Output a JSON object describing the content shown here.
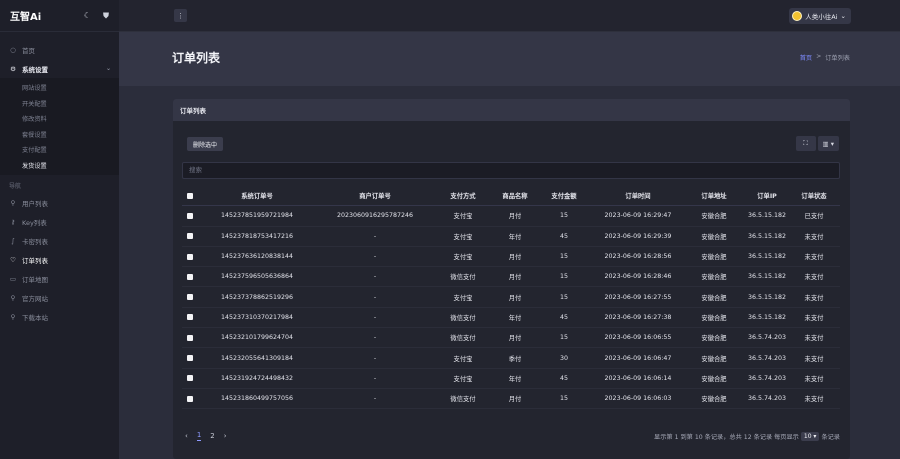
{
  "app": {
    "brand": "互智Ai"
  },
  "sidebar": {
    "items": [
      {
        "label": "首页",
        "icon": "circle-icon"
      },
      {
        "label": "系统设置",
        "icon": "gear-icon"
      }
    ],
    "sub_items": [
      "网站设置",
      "开关配置",
      "修改资料",
      "套餐设置",
      "支付配置",
      "发货设置"
    ],
    "section_label": "导航",
    "nav_items": [
      {
        "label": "用户列表",
        "icon": "user-icon"
      },
      {
        "label": "Key列表",
        "icon": "key-icon"
      },
      {
        "label": "卡密列表",
        "icon": "card-icon"
      },
      {
        "label": "订单列表",
        "icon": "heart-icon"
      },
      {
        "label": "订单地图",
        "icon": "map-icon"
      },
      {
        "label": "官方网站",
        "icon": "search-icon"
      },
      {
        "label": "下载本站",
        "icon": "search-icon"
      }
    ]
  },
  "topbar": {
    "menu_glyph": "⋮",
    "user": "人类小往Ai"
  },
  "header": {
    "title": "订单列表",
    "breadcrumb_home": "首页",
    "breadcrumb_sep": ">",
    "breadcrumb_current": "订单列表"
  },
  "card": {
    "title": "订单列表",
    "delete_label": "删除选中",
    "search_placeholder": "搜索"
  },
  "table": {
    "columns": [
      "系统订单号",
      "商户订单号",
      "支付方式",
      "商品名称",
      "支付金额",
      "订单时间",
      "订单地址",
      "订单IP",
      "订单状态"
    ],
    "rows": [
      [
        "145237851959721984",
        "2023060916295787246",
        "支付宝",
        "月付",
        "15",
        "2023-06-09 16:29:47",
        "安徽合肥",
        "36.5.15.182",
        "已支付"
      ],
      [
        "145237818753417216",
        "-",
        "支付宝",
        "年付",
        "45",
        "2023-06-09 16:29:39",
        "安徽合肥",
        "36.5.15.182",
        "未支付"
      ],
      [
        "145237636120838144",
        "-",
        "支付宝",
        "月付",
        "15",
        "2023-06-09 16:28:56",
        "安徽合肥",
        "36.5.15.182",
        "未支付"
      ],
      [
        "145237596505636864",
        "-",
        "微信支付",
        "月付",
        "15",
        "2023-06-09 16:28:46",
        "安徽合肥",
        "36.5.15.182",
        "未支付"
      ],
      [
        "145237378862519296",
        "-",
        "支付宝",
        "月付",
        "15",
        "2023-06-09 16:27:55",
        "安徽合肥",
        "36.5.15.182",
        "未支付"
      ],
      [
        "145237310370217984",
        "-",
        "微信支付",
        "年付",
        "45",
        "2023-06-09 16:27:38",
        "安徽合肥",
        "36.5.15.182",
        "未支付"
      ],
      [
        "145232101799624704",
        "-",
        "微信支付",
        "月付",
        "15",
        "2023-06-09 16:06:55",
        "安徽合肥",
        "36.5.74.203",
        "未支付"
      ],
      [
        "145232055641309184",
        "-",
        "支付宝",
        "季付",
        "30",
        "2023-06-09 16:06:47",
        "安徽合肥",
        "36.5.74.203",
        "未支付"
      ],
      [
        "145231924724498432",
        "-",
        "支付宝",
        "年付",
        "45",
        "2023-06-09 16:06:14",
        "安徽合肥",
        "36.5.74.203",
        "未支付"
      ],
      [
        "145231860499757056",
        "-",
        "微信支付",
        "月付",
        "15",
        "2023-06-09 16:06:03",
        "安徽合肥",
        "36.5.74.203",
        "未支付"
      ]
    ]
  },
  "pager": {
    "prev": "‹",
    "next": "›",
    "pages": [
      "1",
      "2"
    ],
    "info_prefix": "显示第 1 到第 10 条记录，总共 12 条记录 每页显示",
    "page_size": "10 ▾",
    "info_suffix": "条记录"
  }
}
